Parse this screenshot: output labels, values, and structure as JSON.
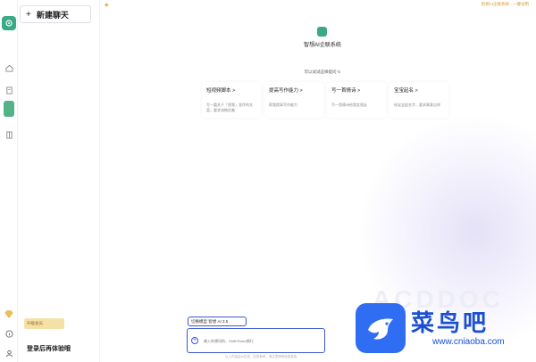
{
  "sidebar": {
    "new_chat_label": "新建聊天",
    "upgrade_label": "升级会员",
    "login_label": "登录后再体验哦"
  },
  "header": {
    "top_link": "智想AI企联系统 · 一键试用"
  },
  "main": {
    "brand_title": "智想AI企联系统",
    "ask_hint": "可以试试这样提问 ↻",
    "cards": [
      {
        "title": "短视频脚本 >",
        "desc": "写一篇关于「视频」宣传的文案，要求流畅优美"
      },
      {
        "title": "提高写作能力 >",
        "desc": "帮我提高写作能力"
      },
      {
        "title": "写一首情诗 >",
        "desc": "写一首情诗给我女朋友"
      },
      {
        "title": "宝宝起名 >",
        "desc": "给宝宝起名字，要求寓意吉祥"
      }
    ],
    "model_badge": "切换模型 智想 AI 3.5",
    "input_placeholder": "输入你想问的，Shift+Enter换行",
    "footer": "以上内容由AI生成，仅供参考，请注意辨别信息真伪"
  },
  "watermark": {
    "name": "菜鸟吧",
    "url": "www.cniaoba.com"
  },
  "colors": {
    "accent": "#3b57d1",
    "brand_green": "#3aa985",
    "gold": "#d19a2a"
  }
}
